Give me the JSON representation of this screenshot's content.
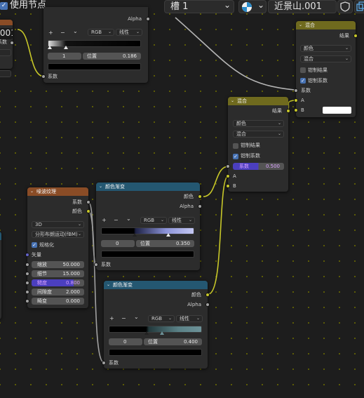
{
  "header": {
    "use_nodes_label": "使用节点",
    "slot_label": "槽 1",
    "material_name": "近景山.001",
    "partial_value": ".001",
    "chevron": "⌄"
  },
  "colors": {
    "mix_header": "#6f6a1e",
    "ramp_header": "#245771",
    "noise_header": "#8a4c26",
    "socket_gray": "#a1a1a1",
    "socket_yellow": "#c7c729",
    "socket_blue": "#6363c7",
    "highlight_field": "#4b3fbf",
    "checkbox_on": "#4772b3"
  },
  "icons": {
    "add": "+",
    "remove": "−",
    "dropdown": "⌄",
    "check": "✓"
  },
  "left_partial_node": {
    "factor_label": "系数"
  },
  "top_ramp_node": {
    "alpha_label": "Alpha",
    "color_mode": "RGB",
    "interpolation": "线性",
    "index": "1",
    "position_label": "位置",
    "position_value": "0.186",
    "factor_label": "系数"
  },
  "mix_node_top": {
    "title": "混合",
    "result_label": "结果",
    "data_type": "颜色",
    "blend_mode": "混合",
    "clamp_result": "钳制结果",
    "clamp_factor": "钳制系数",
    "clamp_result_checked": false,
    "clamp_factor_checked": true,
    "factor_label": "系数",
    "a_label": "A",
    "b_label": "B",
    "b_color": "#ffffff"
  },
  "mix_node_mid": {
    "title": "混合",
    "result_label": "结果",
    "data_type": "颜色",
    "blend_mode": "混合",
    "clamp_result": "钳制结果",
    "clamp_factor": "钳制系数",
    "clamp_result_checked": false,
    "clamp_factor_checked": true,
    "factor_label": "系数",
    "factor_value": "0.500",
    "a_label": "A",
    "b_label": "B"
  },
  "noise_node": {
    "title": "噪波纹理",
    "factor_out": "系数",
    "color_out": "颜色",
    "dimensions": "3D",
    "noise_type": "分形布朗运动(fBM)",
    "normalize_label": "规格化",
    "normalize_checked": true,
    "vector_label": "矢量",
    "fields": [
      {
        "label": "缩放",
        "value": "50.000"
      },
      {
        "label": "细节",
        "value": "15.000"
      },
      {
        "label": "糙度",
        "value": "0.800"
      },
      {
        "label": "间隙度",
        "value": "2.000"
      },
      {
        "label": "畸变",
        "value": "0.000"
      }
    ]
  },
  "ramp_node_mid": {
    "title": "颜色渐变",
    "color_out": "颜色",
    "alpha_out": "Alpha",
    "color_mode": "RGB",
    "interpolation": "线性",
    "index": "0",
    "position_label": "位置",
    "position_value": "0.350",
    "factor_label": "系数"
  },
  "ramp_node_low": {
    "title": "颜色渐变",
    "color_out": "颜色",
    "alpha_out": "Alpha",
    "color_mode": "RGB",
    "interpolation": "线性",
    "index": "0",
    "position_label": "位置",
    "position_value": "0.400",
    "factor_label": "系数"
  }
}
